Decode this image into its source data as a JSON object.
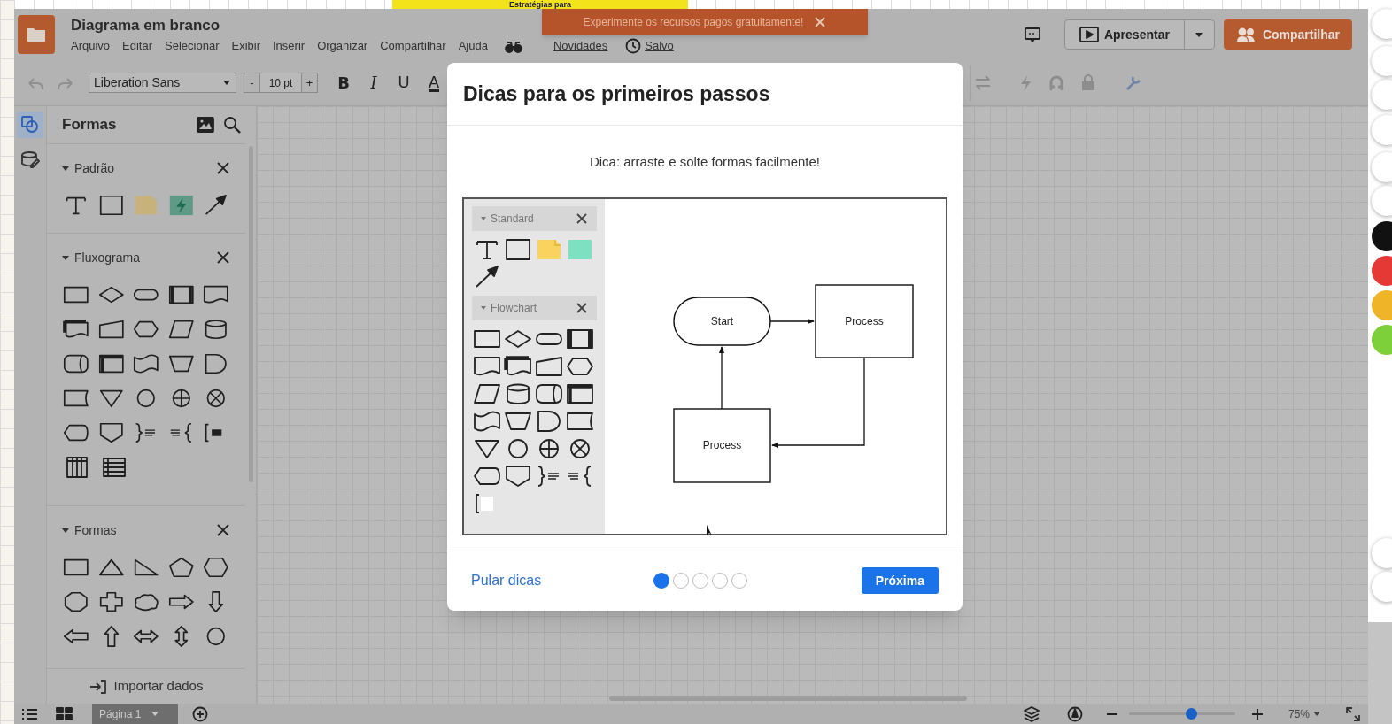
{
  "background_banner": {
    "text": "Estratégias para"
  },
  "header": {
    "title": "Diagrama em branco",
    "menu": [
      "Arquivo",
      "Editar",
      "Selecionar",
      "Exibir",
      "Inserir",
      "Organizar",
      "Compartilhar",
      "Ajuda"
    ],
    "links": [
      "Novidades",
      "Salvo"
    ],
    "present_button": "Apresentar",
    "share_button": "Compartilhar"
  },
  "promo": {
    "text": "Experimente os recursos pagos gratuitamente!"
  },
  "toolbar": {
    "font": "Liberation Sans",
    "size_minus": "-",
    "font_size": "10 pt",
    "size_plus": "+",
    "format": [
      "B",
      "I",
      "U",
      "A"
    ]
  },
  "rail": [
    {
      "selected": true
    },
    {
      "selected": false
    }
  ],
  "sidebar": {
    "title": "Formas",
    "sections": [
      {
        "title": "Padrão",
        "expanded": true
      },
      {
        "title": "Fluxograma",
        "expanded": true
      },
      {
        "title": "Formas",
        "expanded": true
      }
    ],
    "import": "Importar dados"
  },
  "modal": {
    "title": "Dicas para os primeiros passos",
    "tip": "Dica: arraste e solte formas facilmente!",
    "illustration": {
      "panels": [
        "Standard",
        "Flowchart"
      ],
      "nodes": [
        {
          "kind": "terminal",
          "label": "Start"
        },
        {
          "kind": "process",
          "label": "Process"
        },
        {
          "kind": "process",
          "label": "Process"
        }
      ]
    },
    "steps": [
      {
        "selected": true
      },
      {
        "selected": false
      },
      {
        "selected": false
      },
      {
        "selected": false
      },
      {
        "selected": false
      }
    ],
    "skip": "Pular dicas",
    "next": "Próxima"
  },
  "bottom_bar": {
    "page_tab": "Página 1",
    "zoom": {
      "level": 0.58,
      "reading": "75%"
    }
  },
  "annotation_palette": [
    {
      "color": "#111111"
    },
    {
      "color": "#e53935"
    },
    {
      "color": "#f0b429"
    },
    {
      "color": "#7ed03a"
    }
  ]
}
